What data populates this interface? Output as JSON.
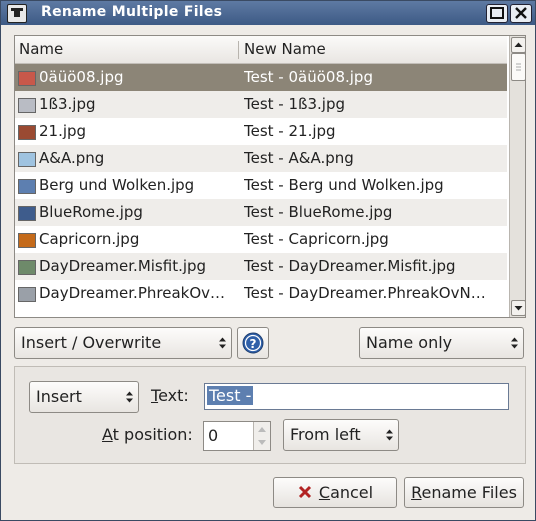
{
  "window": {
    "title": "Rename Multiple Files"
  },
  "list": {
    "columns": [
      "Name",
      "New Name"
    ],
    "rows": [
      {
        "name": "0äüö08.jpg",
        "new_name": "Test - 0äüö08.jpg",
        "thumb": "#c8584a",
        "selected": true
      },
      {
        "name": "1ß3.jpg",
        "new_name": "Test - 1ß3.jpg",
        "thumb": "#b9bcc4"
      },
      {
        "name": "21.jpg",
        "new_name": "Test - 21.jpg",
        "thumb": "#9a4a32"
      },
      {
        "name": "A&A.png",
        "new_name": "Test - A&A.png",
        "thumb": "#9fc3e0"
      },
      {
        "name": "Berg und Wolken.jpg",
        "new_name": "Test - Berg und Wolken.jpg",
        "thumb": "#5d7fb0"
      },
      {
        "name": "BlueRome.jpg",
        "new_name": "Test - BlueRome.jpg",
        "thumb": "#3e5c8c"
      },
      {
        "name": "Capricorn.jpg",
        "new_name": "Test - Capricorn.jpg",
        "thumb": "#c46a1a"
      },
      {
        "name": "DayDreamer.Misfit.jpg",
        "new_name": "Test - DayDreamer.Misfit.jpg",
        "thumb": "#6e8a6a"
      },
      {
        "name": "DayDreamer.PhreakOv…",
        "new_name": "Test - DayDreamer.PhreakOvN…",
        "thumb": "#9aa0a8"
      }
    ]
  },
  "controls": {
    "mode_select": "Insert / Overwrite",
    "scope_select": "Name only",
    "action_select": "Insert",
    "text_label": "Text:",
    "text_value": "Test -",
    "position_label": "At position:",
    "position_value": "0",
    "direction_select": "From left"
  },
  "buttons": {
    "cancel": "Cancel",
    "rename": "Rename Files"
  },
  "colors": {
    "titlebar": "#4a6890",
    "selection": "#8c8577",
    "text_selection": "#5d7fb0",
    "cancel_icon": "#b22222"
  }
}
